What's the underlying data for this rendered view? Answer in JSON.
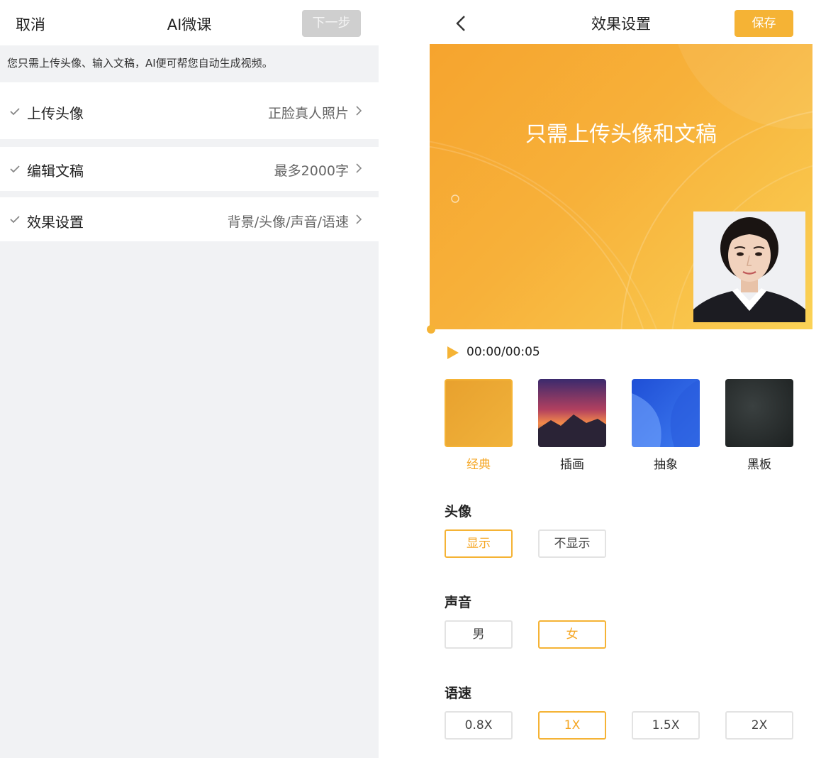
{
  "left": {
    "header": {
      "cancel": "取消",
      "title": "AI微课",
      "next": "下一步"
    },
    "hint": "您只需上传头像、输入文稿，AI便可帮您自动生成视频。",
    "rows": [
      {
        "label": "上传头像",
        "value": "正脸真人照片"
      },
      {
        "label": "编辑文稿",
        "value": "最多2000字"
      },
      {
        "label": "效果设置",
        "value": "背景/头像/声音/语速"
      }
    ]
  },
  "right": {
    "header": {
      "title": "效果设置",
      "save": "保存"
    },
    "preview": {
      "text": "只需上传头像和文稿"
    },
    "player": {
      "time": "00:00/00:05"
    },
    "backgrounds": [
      {
        "label": "经典",
        "selected": true
      },
      {
        "label": "插画",
        "selected": false
      },
      {
        "label": "抽象",
        "selected": false
      },
      {
        "label": "黑板",
        "selected": false
      }
    ],
    "avatar_section": {
      "title": "头像",
      "options": [
        "显示",
        "不显示"
      ],
      "selected": "显示"
    },
    "voice_section": {
      "title": "声音",
      "options": [
        "男",
        "女"
      ],
      "selected": "女"
    },
    "speed_section": {
      "title": "语速",
      "options": [
        "0.8X",
        "1X",
        "1.5X",
        "2X"
      ],
      "selected": "1X"
    }
  },
  "colors": {
    "accent": "#f5b335",
    "accent_text": "#f5a623",
    "disabled": "#cfcfcf",
    "panel_bg": "#f1f2f4"
  },
  "icons": [
    "check-icon",
    "chevron-right-icon",
    "back-arrow-icon",
    "play-icon"
  ]
}
